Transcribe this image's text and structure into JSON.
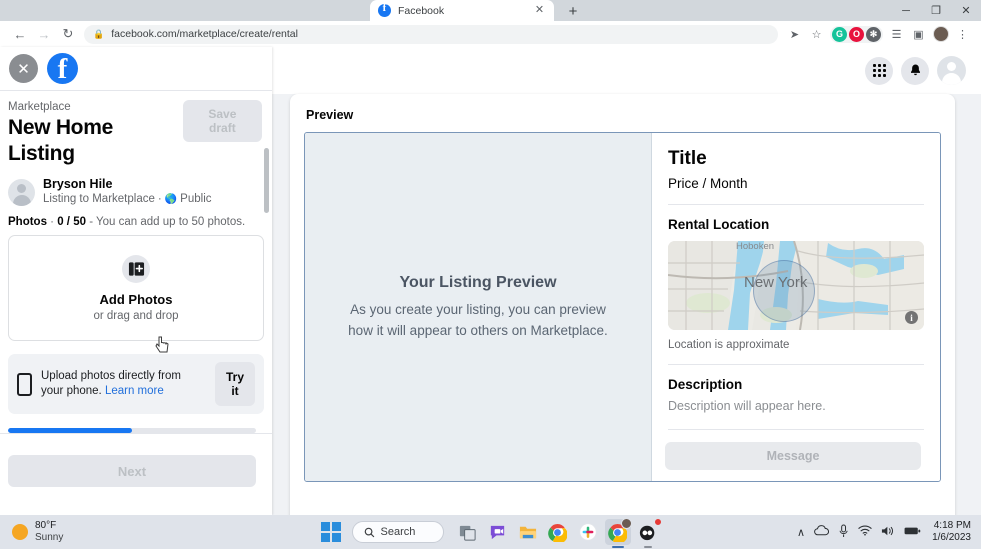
{
  "browser": {
    "tab": {
      "title": "Facebook",
      "favicon": "facebook-icon",
      "close": "✕"
    },
    "newtab_label": "+",
    "window_controls": {
      "minimize": "─",
      "maximize": "❐",
      "close": "✕"
    },
    "nav": {
      "back": "←",
      "forward": "→",
      "reload": "↻"
    },
    "address": {
      "lock_icon": "lock-icon",
      "url": "facebook.com/marketplace/create/rental"
    },
    "toolbar_icons": [
      {
        "name": "share-icon",
        "glyph": "➦"
      },
      {
        "name": "bookmark-star-icon",
        "glyph": "☆"
      },
      {
        "name": "grammarly-extension-icon",
        "glyph": "G",
        "color": "#15c39a"
      },
      {
        "name": "honey-extension-icon",
        "glyph": "O",
        "color": "#e8123d"
      },
      {
        "name": "extensions-puzzle-icon",
        "glyph": "✻"
      },
      {
        "name": "media-list-icon",
        "glyph": "☰"
      },
      {
        "name": "split-screen-icon",
        "glyph": "▢"
      },
      {
        "name": "browser-profile-avatar",
        "glyph": ""
      },
      {
        "name": "chrome-menu-icon",
        "glyph": "⋮"
      }
    ]
  },
  "fb_header": {
    "grid_icon": "apps-grid-icon",
    "bell_icon": "notifications-bell-icon",
    "avatar": "profile-avatar"
  },
  "sidebar": {
    "close_icon": "close-icon",
    "logo": "facebook-logo",
    "breadcrumb": "Marketplace",
    "title": "New Home Listing",
    "save_draft_label": "Save draft",
    "user": {
      "name": "Bryson Hile",
      "subtitle_prefix": "Listing to Marketplace",
      "separator": "·",
      "privacy": "Public",
      "privacy_icon": "globe-icon"
    },
    "photos_label_prefix": "Photos",
    "photos_count": "0 / 50",
    "photos_label_suffix": "You can add up to 50 photos.",
    "dropzone": {
      "icon": "add-photo-icon",
      "title": "Add Photos",
      "subtitle": "or drag and drop"
    },
    "tryit": {
      "icon": "phone-icon",
      "text": "Upload photos directly from your phone.",
      "link": "Learn more",
      "button_label": "Try it"
    },
    "progress_percent": 50,
    "next_label": "Next"
  },
  "preview": {
    "panel_label": "Preview",
    "empty_state": {
      "heading": "Your Listing Preview",
      "line1": "As you create your listing, you can preview",
      "line2": "how it will appear to others on Marketplace."
    },
    "listing": {
      "title": "Title",
      "price": "Price / Month",
      "location_heading": "Rental Location",
      "map": {
        "city_label": "New York",
        "secondary_label": "Hoboken",
        "info_icon": "info-icon"
      },
      "approx_note": "Location is approximate",
      "description_heading": "Description",
      "description_placeholder": "Description will appear here.",
      "message_button": "Message"
    }
  },
  "taskbar": {
    "weather": {
      "temp": "80°F",
      "condition": "Sunny",
      "icon": "sun-icon"
    },
    "start_icon": "windows-start-icon",
    "search_label": "Search",
    "search_icon": "search-icon",
    "apps": [
      {
        "name": "task-view-icon"
      },
      {
        "name": "teams-chat-icon"
      },
      {
        "name": "file-explorer-icon"
      },
      {
        "name": "chrome-icon"
      },
      {
        "name": "slack-icon"
      },
      {
        "name": "chrome-active-icon"
      },
      {
        "name": "recorder-icon"
      }
    ],
    "tray": {
      "overflow": "∧",
      "onedrive_icon": "cloud-icon",
      "mic_icon": "microphone-icon",
      "wifi_icon": "wifi-icon",
      "volume_icon": "speaker-icon",
      "battery_icon": "battery-icon",
      "time": "4:18 PM",
      "date": "1/6/2023"
    }
  },
  "colors": {
    "fb_blue": "#1877f2",
    "page_bg": "#f0f2f5",
    "preview_border": "#7a96b8"
  }
}
